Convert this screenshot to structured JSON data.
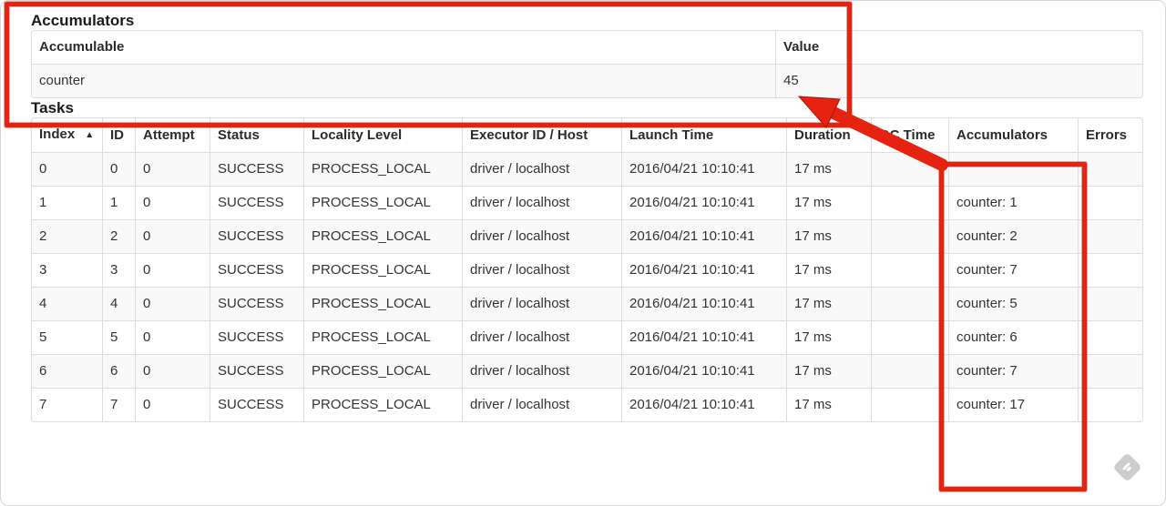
{
  "annotations": {
    "color": "#e62310",
    "arrow_outline": "#a81604"
  },
  "accumulators_section": {
    "title": "Accumulators",
    "columns": [
      "Accumulable",
      "Value"
    ],
    "rows": [
      {
        "accumulable": "counter",
        "value": "45"
      }
    ]
  },
  "tasks_section": {
    "title": "Tasks",
    "sort_indicator": "▲",
    "columns": [
      "Index",
      "ID",
      "Attempt",
      "Status",
      "Locality Level",
      "Executor ID / Host",
      "Launch Time",
      "Duration",
      "GC Time",
      "Accumulators",
      "Errors"
    ],
    "rows": [
      {
        "index": "0",
        "id": "0",
        "attempt": "0",
        "status": "SUCCESS",
        "locality_level": "PROCESS_LOCAL",
        "executor_id_host": "driver / localhost",
        "launch_time": "2016/04/21 10:10:41",
        "duration": "17 ms",
        "gc_time": "",
        "accumulators": "",
        "errors": ""
      },
      {
        "index": "1",
        "id": "1",
        "attempt": "0",
        "status": "SUCCESS",
        "locality_level": "PROCESS_LOCAL",
        "executor_id_host": "driver / localhost",
        "launch_time": "2016/04/21 10:10:41",
        "duration": "17 ms",
        "gc_time": "",
        "accumulators": "counter: 1",
        "errors": ""
      },
      {
        "index": "2",
        "id": "2",
        "attempt": "0",
        "status": "SUCCESS",
        "locality_level": "PROCESS_LOCAL",
        "executor_id_host": "driver / localhost",
        "launch_time": "2016/04/21 10:10:41",
        "duration": "17 ms",
        "gc_time": "",
        "accumulators": "counter: 2",
        "errors": ""
      },
      {
        "index": "3",
        "id": "3",
        "attempt": "0",
        "status": "SUCCESS",
        "locality_level": "PROCESS_LOCAL",
        "executor_id_host": "driver / localhost",
        "launch_time": "2016/04/21 10:10:41",
        "duration": "17 ms",
        "gc_time": "",
        "accumulators": "counter: 7",
        "errors": ""
      },
      {
        "index": "4",
        "id": "4",
        "attempt": "0",
        "status": "SUCCESS",
        "locality_level": "PROCESS_LOCAL",
        "executor_id_host": "driver / localhost",
        "launch_time": "2016/04/21 10:10:41",
        "duration": "17 ms",
        "gc_time": "",
        "accumulators": "counter: 5",
        "errors": ""
      },
      {
        "index": "5",
        "id": "5",
        "attempt": "0",
        "status": "SUCCESS",
        "locality_level": "PROCESS_LOCAL",
        "executor_id_host": "driver / localhost",
        "launch_time": "2016/04/21 10:10:41",
        "duration": "17 ms",
        "gc_time": "",
        "accumulators": "counter: 6",
        "errors": ""
      },
      {
        "index": "6",
        "id": "6",
        "attempt": "0",
        "status": "SUCCESS",
        "locality_level": "PROCESS_LOCAL",
        "executor_id_host": "driver / localhost",
        "launch_time": "2016/04/21 10:10:41",
        "duration": "17 ms",
        "gc_time": "",
        "accumulators": "counter: 7",
        "errors": ""
      },
      {
        "index": "7",
        "id": "7",
        "attempt": "0",
        "status": "SUCCESS",
        "locality_level": "PROCESS_LOCAL",
        "executor_id_host": "driver / localhost",
        "launch_time": "2016/04/21 10:10:41",
        "duration": "17 ms",
        "gc_time": "",
        "accumulators": "counter: 17",
        "errors": ""
      }
    ]
  },
  "watermark_icon": "feedly-diamond"
}
